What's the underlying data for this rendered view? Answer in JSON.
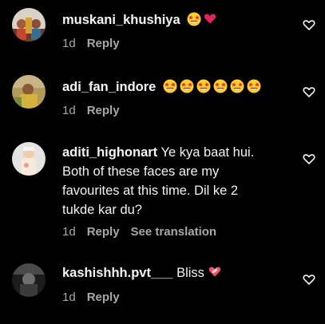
{
  "colors": {
    "background": "#000000",
    "text": "#f5f5f5",
    "meta": "#a8a8a8",
    "heart_red": "#e0245e"
  },
  "comments": [
    {
      "username": "muskani_khushiya",
      "text": "",
      "emojis": [
        "star-struck-emoji",
        "red-heart-emoji"
      ],
      "time": "1d",
      "reply": "Reply"
    },
    {
      "username": "adi_fan_indore",
      "text": "",
      "emojis": [
        "star-struck-emoji",
        "star-struck-emoji",
        "star-struck-emoji",
        "star-struck-emoji",
        "star-struck-emoji",
        "star-struck-emoji"
      ],
      "time": "1d",
      "reply": "Reply"
    },
    {
      "username": "aditi_highonart",
      "text_lines": [
        "Ye kya baat hui.",
        "Both of these faces are my",
        "favourites at this time. Dil ke 2",
        "tukde kar du?"
      ],
      "time": "1d",
      "reply": "Reply",
      "see_translation": "See translation"
    },
    {
      "username": "kashishhh.pvt___",
      "text": "Bliss",
      "emojis": [
        "mending-heart-emoji"
      ],
      "time": "1d",
      "reply": "Reply"
    }
  ]
}
